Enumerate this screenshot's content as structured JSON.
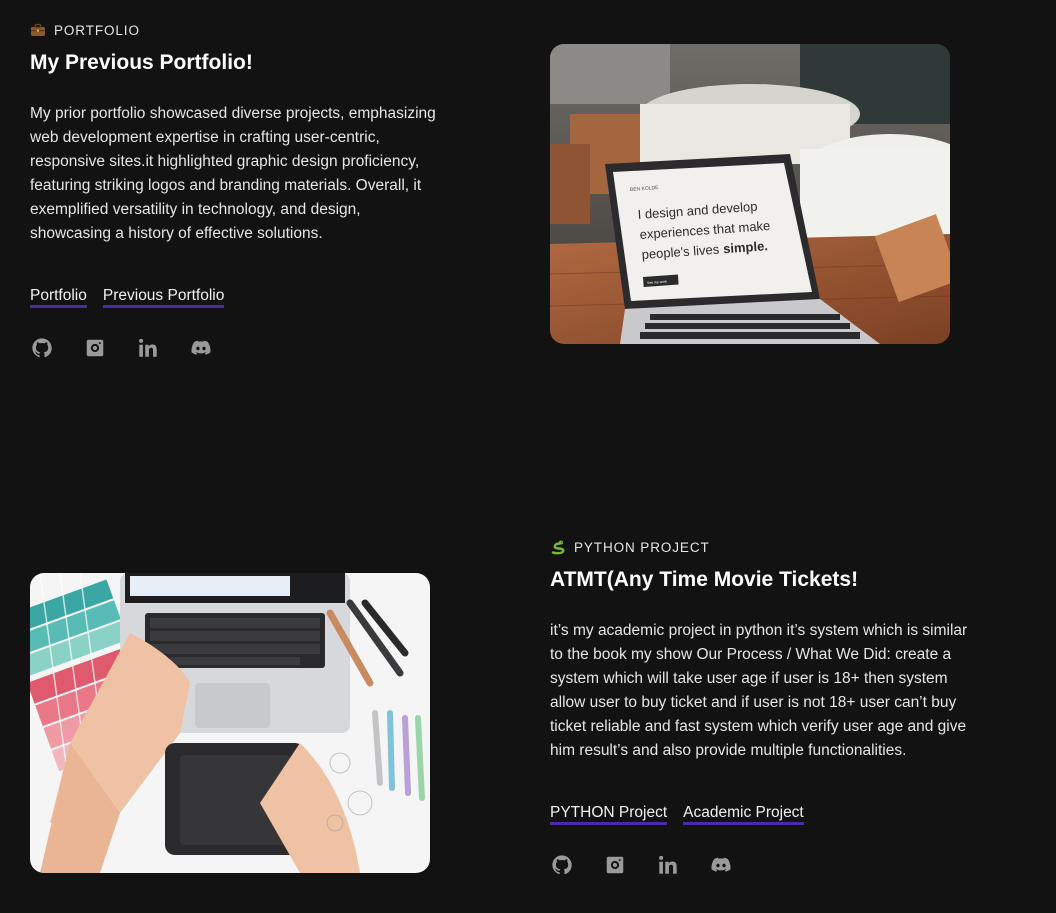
{
  "projects": [
    {
      "kicker": "PORTFOLIO",
      "kicker_icon": "briefcase-icon",
      "title": "My Previous Portfolio!",
      "description": "My prior portfolio showcased diverse projects, emphasizing web development expertise in crafting user-centric, responsive sites.it highlighted graphic design proficiency, featuring striking logos and branding materials. Overall, it exemplified versatility in technology, and design, showcasing a history of effective solutions.",
      "tags": [
        "Portfolio",
        "Previous Portfolio"
      ],
      "image_screen_text": {
        "brand": "BEN KOLDE",
        "headline_1": "I design and develop",
        "headline_2": "experiences that make",
        "headline_3": "people's lives",
        "headline_bold": "simple.",
        "cta": "See my work"
      }
    },
    {
      "kicker": "PYTHON PROJECT",
      "kicker_icon": "snake-icon",
      "title": "ATMT(Any Time Movie Tickets!",
      "description": "it’s my academic project in python it’s system which is similar to the book my show Our Process / What We Did: create a system which will take user age if user is 18+ then system allow user to buy ticket and if user is not 18+ user can’t buy ticket reliable and fast system which verify user age and give him result’s and also provide multiple functionalities.",
      "tags": [
        "PYTHON Project",
        "Academic Project"
      ]
    }
  ],
  "social_icons": [
    "github-icon",
    "instagram-icon",
    "linkedin-icon",
    "discord-icon"
  ],
  "colors": {
    "background": "#121212",
    "tag_underline": "#4b2aa8",
    "icon": "#9a9a9a"
  }
}
